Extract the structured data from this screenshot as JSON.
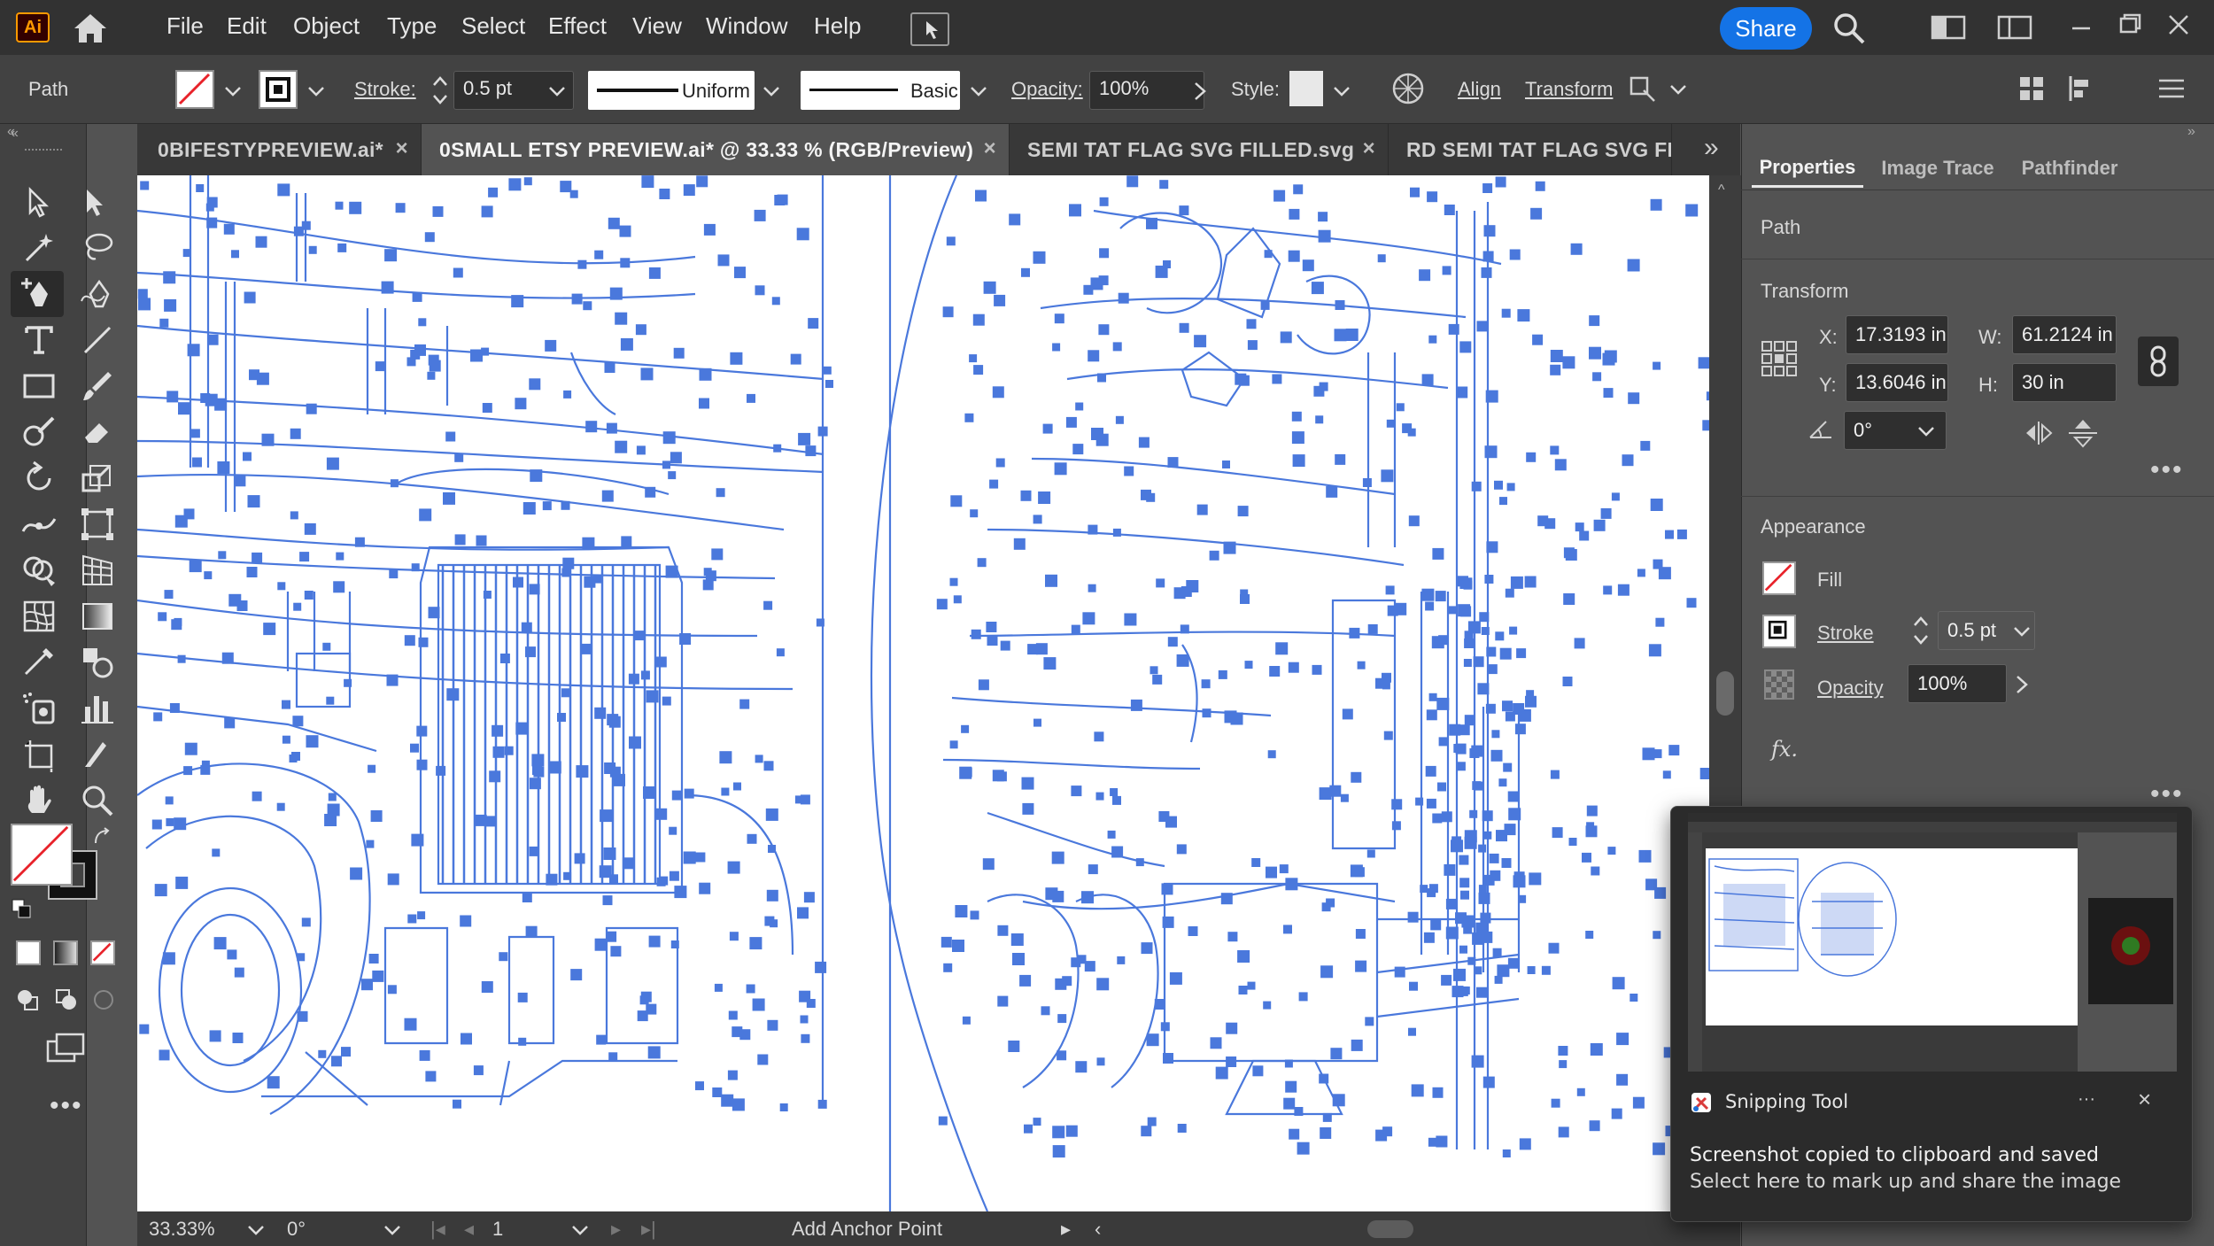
{
  "app": {
    "logo": "Ai",
    "menu": [
      "File",
      "Edit",
      "Object",
      "Type",
      "Select",
      "Effect",
      "View",
      "Window",
      "Help"
    ],
    "share_label": "Share"
  },
  "control_bar": {
    "object_type": "Path",
    "stroke_label": "Stroke:",
    "stroke_weight": "0.5 pt",
    "profile": "Uniform",
    "brush": "Basic",
    "opacity_label": "Opacity:",
    "opacity_value": "100%",
    "style_label": "Style:",
    "align_label": "Align",
    "transform_label": "Transform"
  },
  "tabs": [
    {
      "label": "0BIFESTYPREVIEW.ai*",
      "active": false
    },
    {
      "label": "0SMALL ETSY PREVIEW.ai* @ 33.33 % (RGB/Preview)",
      "active": true
    },
    {
      "label": "SEMI TAT FLAG SVG FILLED.svg",
      "active": false
    },
    {
      "label": "RD SEMI TAT FLAG SVG FI",
      "active": false
    }
  ],
  "status_bar": {
    "zoom": "33.33%",
    "rotation": "0°",
    "artboard": "1",
    "tool_hint": "Add Anchor Point"
  },
  "properties": {
    "tabs": [
      "Properties",
      "Image Trace",
      "Pathfinder"
    ],
    "object_type": "Path",
    "transform_title": "Transform",
    "x_label": "X:",
    "x": "17.3193 in",
    "y_label": "Y:",
    "y": "13.6046 in",
    "w_label": "W:",
    "w": "61.2124 in",
    "h_label": "H:",
    "h": "30 in",
    "angle": "0°",
    "appearance_title": "Appearance",
    "fill_label": "Fill",
    "stroke_label": "Stroke",
    "stroke_weight": "0.5 pt",
    "opacity_label": "Opacity",
    "opacity_value": "100%",
    "fx_label": "fx."
  },
  "notification": {
    "app": "Snipping Tool",
    "line1": "Screenshot copied to clipboard and saved",
    "line2": "Select here to mark up and share the image"
  },
  "colors": {
    "path_stroke": "#4a78dc",
    "anchor_fill": "#4a78dc",
    "share_button": "#1473e6",
    "ai_logo": "#ff9a00"
  }
}
